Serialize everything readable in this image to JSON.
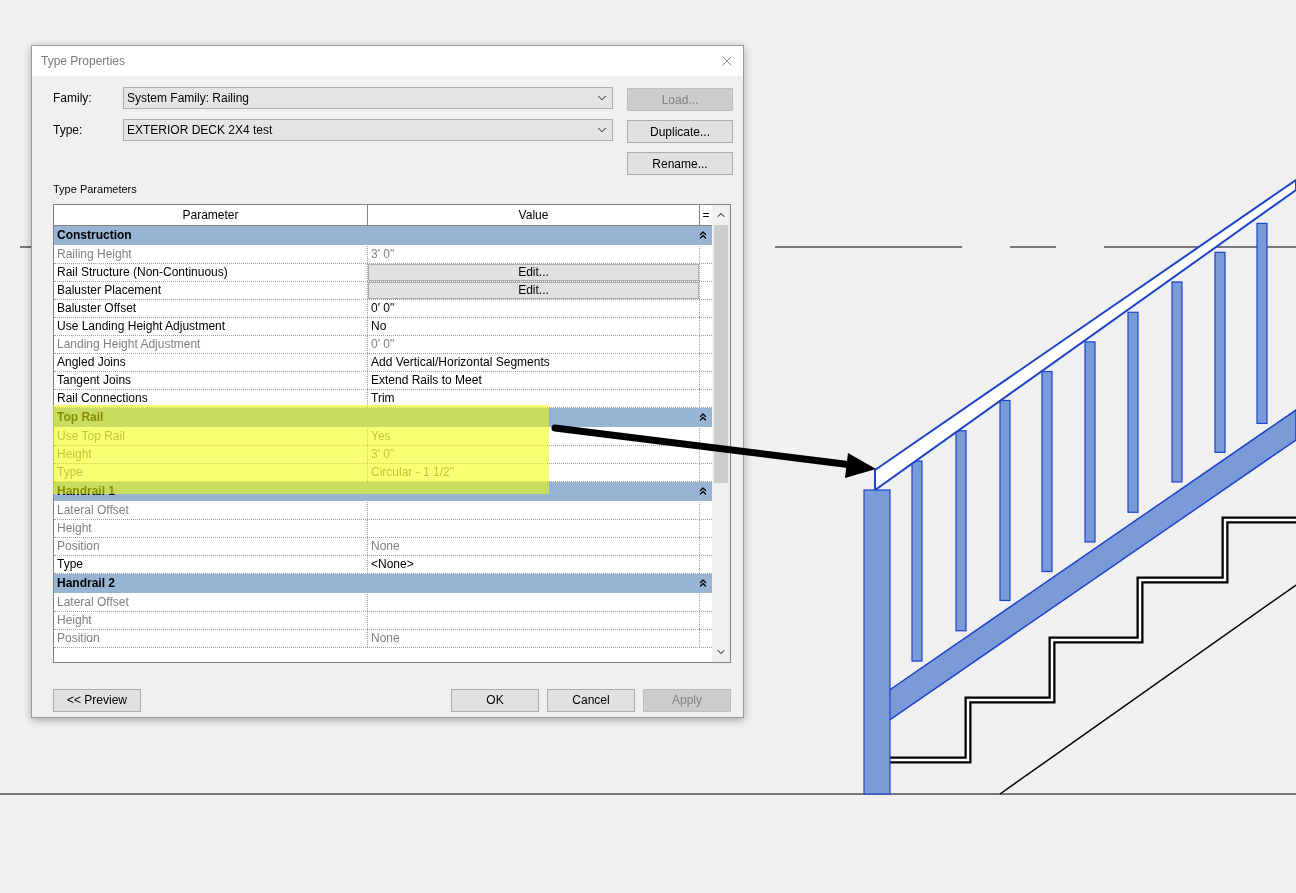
{
  "dialog": {
    "title": "Type Properties",
    "family": {
      "label": "Family:",
      "value": "System Family: Railing"
    },
    "type": {
      "label": "Type:",
      "value": "EXTERIOR DECK 2X4 test"
    },
    "side_buttons": [
      {
        "label": "Load...",
        "disabled": true
      },
      {
        "label": "Duplicate...",
        "disabled": false
      },
      {
        "label": "Rename...",
        "disabled": false
      }
    ],
    "section_label": "Type Parameters",
    "columns": [
      "Parameter",
      "Value",
      "="
    ],
    "groups": [
      {
        "name": "Construction",
        "expanded": true,
        "rows": [
          {
            "parameter": "Railing Height",
            "value": "3'  0\"",
            "kind": "text",
            "disabled": true
          },
          {
            "parameter": "Rail Structure (Non-Continuous)",
            "value": "Edit...",
            "kind": "button",
            "disabled": false
          },
          {
            "parameter": "Baluster Placement",
            "value": "Edit...",
            "kind": "button",
            "disabled": false
          },
          {
            "parameter": "Baluster Offset",
            "value": "0'  0\"",
            "kind": "text",
            "disabled": false
          },
          {
            "parameter": "Use Landing Height Adjustment",
            "value": "No",
            "kind": "text",
            "disabled": false
          },
          {
            "parameter": "Landing Height Adjustment",
            "value": "0'  0\"",
            "kind": "text",
            "disabled": true
          },
          {
            "parameter": "Angled Joins",
            "value": "Add Vertical/Horizontal Segments",
            "kind": "text",
            "disabled": false
          },
          {
            "parameter": "Tangent Joins",
            "value": "Extend Rails to Meet",
            "kind": "text",
            "disabled": false
          },
          {
            "parameter": "Rail Connections",
            "value": "Trim",
            "kind": "text",
            "disabled": false
          }
        ]
      },
      {
        "name": "Top Rail",
        "expanded": true,
        "rows": [
          {
            "parameter": "Use Top Rail",
            "value": "Yes",
            "kind": "text",
            "disabled": true
          },
          {
            "parameter": "Height",
            "value": "3'  0\"",
            "kind": "text",
            "disabled": true
          },
          {
            "parameter": "Type",
            "value": "Circular - 1 1/2\"",
            "kind": "text",
            "disabled": true
          }
        ]
      },
      {
        "name": "Handrail 1",
        "expanded": true,
        "rows": [
          {
            "parameter": "Lateral Offset",
            "value": "",
            "kind": "text",
            "disabled": true
          },
          {
            "parameter": "Height",
            "value": "",
            "kind": "text",
            "disabled": true
          },
          {
            "parameter": "Position",
            "value": "None",
            "kind": "text",
            "disabled": true
          },
          {
            "parameter": "Type",
            "value": "<None>",
            "kind": "text",
            "disabled": false
          }
        ]
      },
      {
        "name": "Handrail 2",
        "expanded": true,
        "rows": [
          {
            "parameter": "Lateral Offset",
            "value": "",
            "kind": "text",
            "disabled": true
          },
          {
            "parameter": "Height",
            "value": "",
            "kind": "text",
            "disabled": true
          },
          {
            "parameter": "Position",
            "value": "None",
            "kind": "text",
            "disabled": true
          }
        ]
      }
    ],
    "preview_button": "<< Preview",
    "footer_buttons": [
      {
        "label": "OK",
        "disabled": false
      },
      {
        "label": "Cancel",
        "disabled": false
      },
      {
        "label": "Apply",
        "disabled": true
      }
    ]
  }
}
